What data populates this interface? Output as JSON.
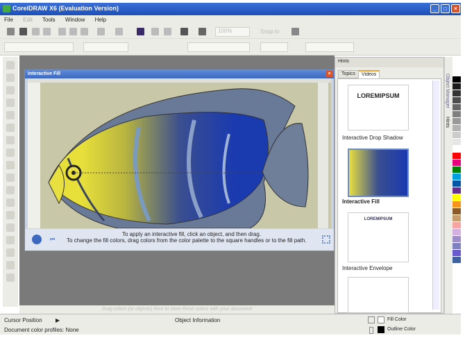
{
  "app": {
    "title": "CorelDRAW X6 (Evaluation Version)"
  },
  "menu": [
    {
      "label": "File"
    },
    {
      "label": "Edit"
    },
    {
      "label": "Tools"
    },
    {
      "label": "Window"
    },
    {
      "label": "Help"
    }
  ],
  "toolbar": {
    "zoom": "100%",
    "snap": "Snap to"
  },
  "fill_window": {
    "title": "Interactive Fill",
    "caption_line1": "To apply an interactive fill, click an object, and then drag.",
    "caption_line2": "To change the fill colors, drag colors from the color palette to the square handles or to the fill path."
  },
  "hints": {
    "title": "Hints",
    "tabs": [
      "Topics",
      "Videos"
    ],
    "active_tab": "Videos",
    "videos": [
      {
        "label": "Interactive Drop Shadow",
        "thumb_text": "LOREMIPSUM"
      },
      {
        "label": "Interactive Fill"
      },
      {
        "label": "Interactive Envelope",
        "thumb_text": "LOREMIPSUM"
      },
      {
        "label": ""
      }
    ]
  },
  "dock_tabs": [
    "Object Manager",
    "Hints"
  ],
  "palette": {
    "colors": [
      "#ffffff",
      "#000000",
      "#1a1a1a",
      "#333333",
      "#4d4d4d",
      "#666666",
      "#808080",
      "#999999",
      "#b3b3b3",
      "#cccccc",
      "#e6e6e6",
      "#ffffff",
      "#ff0000",
      "#e6007e",
      "#008000",
      "#00a0e0",
      "#0055a5",
      "#662d91",
      "#ffff00",
      "#f7941d",
      "#8b5a2b",
      "#c69c6d",
      "#f5a3a3",
      "#d4b0e0",
      "#a08cc8",
      "#8080c0",
      "#6a5acd",
      "#4060a0"
    ]
  },
  "color_strip": {
    "hint": "Drag colors (or objects) here to store these colors with your document"
  },
  "status": {
    "cursor_position": "Cursor Position",
    "object_info": "Object Information",
    "color_profiles": "Document color profiles: None",
    "fill_label": "Fill Color",
    "outline_label": "Outline Color",
    "fill_color": "#ffffff",
    "outline_color": "#000000"
  }
}
